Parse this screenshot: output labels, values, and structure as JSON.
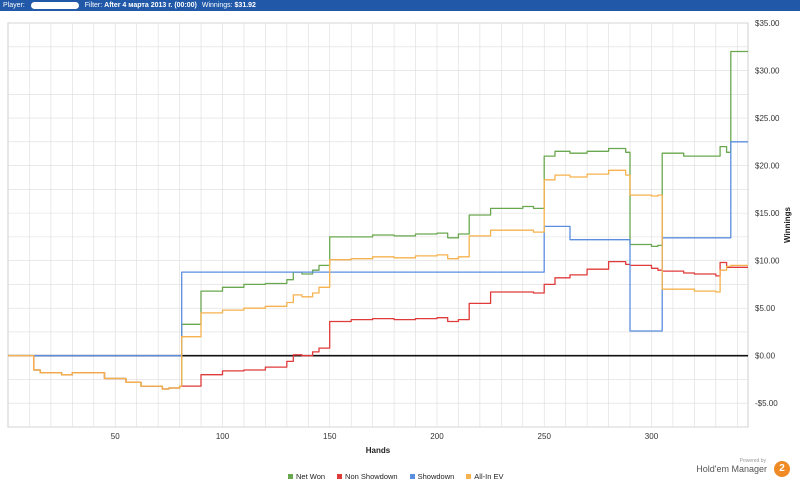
{
  "header": {
    "player_label": "Player:",
    "filter_label": "Filter:",
    "filter_value": "After 4 марта 2013 г. (00:00)",
    "winnings_label": "Winnings:",
    "winnings_value": "$31.92"
  },
  "footer": {
    "powered_by": "Powered by",
    "brand_name": "Hold'em Manager",
    "brand_logo_text": "2"
  },
  "colors": {
    "net_won": "#6aa84f",
    "non_showdown": "#e03a3a",
    "showdown": "#5b8ee0",
    "all_in_ev": "#f6b24e",
    "zero_line": "#111111",
    "grid": "#dcdcdc",
    "header_bg": "#2159a8"
  },
  "chart_data": {
    "type": "line",
    "xlabel": "Hands",
    "ylabel": "Winnings",
    "xlim": [
      0,
      345
    ],
    "ylim": [
      -7.5,
      35
    ],
    "x_ticks": [
      50,
      100,
      150,
      200,
      250,
      300
    ],
    "y_ticks": [
      -5,
      0,
      5,
      10,
      15,
      20,
      25,
      30,
      35
    ],
    "y_tick_labels": [
      "-$5.00",
      "$0.00",
      "$5.00",
      "$10.00",
      "$15.00",
      "$20.00",
      "$25.00",
      "$30.00",
      "$35.00"
    ],
    "grid": true,
    "legend_position": "bottom",
    "series": [
      {
        "name": "Net Won",
        "color": "#6aa84f",
        "x": [
          0,
          8,
          12,
          15,
          25,
          30,
          45,
          55,
          62,
          68,
          72,
          75,
          78,
          80,
          81,
          90,
          100,
          110,
          120,
          130,
          133,
          137,
          142,
          145,
          150,
          160,
          170,
          180,
          190,
          200,
          205,
          210,
          215,
          225,
          240,
          245,
          250,
          255,
          262,
          270,
          280,
          288,
          290,
          300,
          303,
          305,
          315,
          320,
          330,
          332,
          335,
          337,
          345
        ],
        "y": [
          0,
          0,
          -1.5,
          -1.8,
          -2,
          -1.8,
          -2.4,
          -2.8,
          -3.2,
          -3.2,
          -3.5,
          -3.4,
          -3.4,
          -3.2,
          3.3,
          6.8,
          7.2,
          7.5,
          7.6,
          8,
          8.8,
          8.6,
          9,
          9.5,
          12.5,
          12.5,
          12.7,
          12.6,
          12.8,
          12.9,
          12.4,
          12.8,
          14.8,
          15.5,
          15.7,
          15.5,
          21,
          21.5,
          21.3,
          21.5,
          21.8,
          21.4,
          11.7,
          11.5,
          11.6,
          21.3,
          21.0,
          21.0,
          21.0,
          22,
          21.4,
          32,
          32
        ]
      },
      {
        "name": "Non Showdown",
        "color": "#e03a3a",
        "x": [
          0,
          8,
          12,
          15,
          25,
          30,
          45,
          55,
          62,
          68,
          72,
          75,
          78,
          80,
          81,
          90,
          100,
          110,
          120,
          130,
          133,
          137,
          142,
          145,
          150,
          160,
          170,
          180,
          190,
          200,
          205,
          210,
          215,
          225,
          240,
          245,
          250,
          255,
          262,
          270,
          280,
          288,
          290,
          300,
          303,
          305,
          315,
          320,
          330,
          332,
          335,
          337,
          345
        ],
        "y": [
          0,
          0,
          -1.5,
          -1.8,
          -2,
          -1.8,
          -2.4,
          -2.8,
          -3.2,
          -3.2,
          -3.5,
          -3.4,
          -3.4,
          -3.2,
          -3.2,
          -2,
          -1.6,
          -1.5,
          -1.2,
          -0.6,
          0.1,
          0,
          0.4,
          0.8,
          3.6,
          3.8,
          3.9,
          3.8,
          3.9,
          4,
          3.6,
          3.8,
          5.5,
          6.7,
          6.7,
          6.6,
          7.5,
          8.2,
          8.5,
          9.1,
          9.9,
          9.6,
          9.5,
          9.2,
          9.0,
          8.9,
          8.7,
          8.6,
          8.4,
          9.8,
          9.3,
          9.3,
          9.3
        ]
      },
      {
        "name": "Showdown",
        "color": "#5b8ee0",
        "x": [
          0,
          8,
          12,
          15,
          25,
          30,
          45,
          55,
          62,
          68,
          72,
          75,
          78,
          80,
          81,
          90,
          100,
          110,
          120,
          130,
          133,
          137,
          142,
          145,
          150,
          160,
          170,
          180,
          190,
          200,
          205,
          210,
          215,
          225,
          240,
          245,
          250,
          255,
          262,
          270,
          280,
          288,
          290,
          300,
          303,
          305,
          315,
          320,
          330,
          332,
          335,
          337,
          345
        ],
        "y": [
          0,
          0,
          0,
          0,
          0,
          0,
          0,
          0,
          0,
          0,
          0,
          0,
          0,
          0,
          8.8,
          8.8,
          8.8,
          8.8,
          8.8,
          8.8,
          8.8,
          8.8,
          8.8,
          8.8,
          8.8,
          8.8,
          8.8,
          8.8,
          8.8,
          8.8,
          8.8,
          8.8,
          8.8,
          8.8,
          8.8,
          8.8,
          13.6,
          13.6,
          12.2,
          12.2,
          12.2,
          12.2,
          2.6,
          2.6,
          2.6,
          12.4,
          12.4,
          12.4,
          12.4,
          12.4,
          12.4,
          22.5,
          22.5
        ]
      },
      {
        "name": "All-In EV",
        "color": "#f6b24e",
        "x": [
          0,
          8,
          12,
          15,
          25,
          30,
          45,
          55,
          62,
          68,
          72,
          75,
          78,
          80,
          81,
          90,
          100,
          110,
          120,
          130,
          133,
          137,
          142,
          145,
          150,
          160,
          170,
          180,
          190,
          200,
          205,
          210,
          215,
          225,
          240,
          245,
          250,
          255,
          262,
          270,
          280,
          288,
          290,
          300,
          303,
          305,
          315,
          320,
          330,
          332,
          335,
          337,
          345
        ],
        "y": [
          0,
          0,
          -1.5,
          -1.8,
          -2,
          -1.8,
          -2.4,
          -2.8,
          -3.2,
          -3.2,
          -3.5,
          -3.4,
          -3.4,
          -3.2,
          2,
          4.5,
          4.8,
          5,
          5.2,
          5.6,
          6.4,
          6.2,
          6.6,
          7.2,
          10.1,
          10.2,
          10.4,
          10.3,
          10.5,
          10.6,
          10.2,
          10.4,
          12.6,
          13.2,
          13.2,
          13.0,
          18.5,
          19.0,
          18.8,
          19.1,
          19.5,
          19.0,
          16.9,
          16.8,
          16.9,
          7.0,
          7.0,
          6.8,
          6.7,
          9,
          9.4,
          9.5,
          9.5
        ]
      }
    ]
  }
}
